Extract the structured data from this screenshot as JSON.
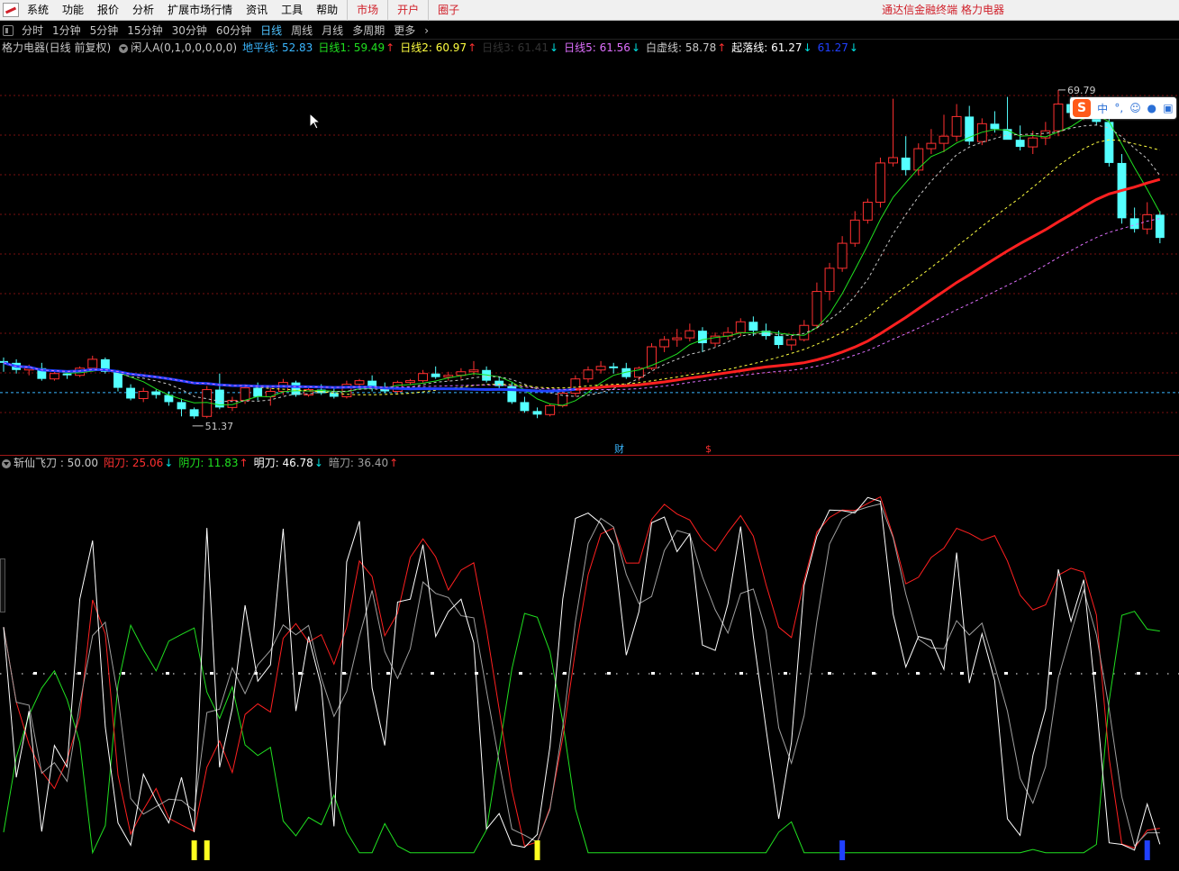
{
  "menu": {
    "items": [
      "系统",
      "功能",
      "报价",
      "分析",
      "扩展市场行情",
      "资讯",
      "工具",
      "帮助"
    ],
    "red_items": [
      "市场",
      "开户",
      "圈子"
    ],
    "right_title": "通达信金融终端   格力电器"
  },
  "periods": {
    "items": [
      "分时",
      "1分钟",
      "5分钟",
      "15分钟",
      "30分钟",
      "60分钟",
      "日线",
      "周线",
      "月线",
      "多周期",
      "更多"
    ],
    "active": "日线"
  },
  "main_legend": {
    "stock": "格力电器(日线 前复权)",
    "indicator": "闲人A(0,1,0,0,0,0,0)",
    "items": [
      {
        "label": "地平线: 52.83",
        "color": "#3ab7ff",
        "arrow": ""
      },
      {
        "label": "日线1: 59.49",
        "color": "#20e020",
        "arrow": "up"
      },
      {
        "label": "日线2: 60.97",
        "color": "#ffff40",
        "arrow": "up"
      },
      {
        "label": "日线3: 61.41",
        "color": "#333333",
        "arrow": "dn"
      },
      {
        "label": "日线5: 61.56",
        "color": "#e070ff",
        "arrow": "dn"
      },
      {
        "label": "白虚线: 58.78",
        "color": "#c8c8c8",
        "arrow": "up"
      },
      {
        "label": "起落线: 61.27",
        "color": "#ffffff",
        "arrow": "dn"
      },
      {
        "label": "61.27",
        "color": "#2040ff",
        "arrow": "dn"
      }
    ]
  },
  "sub_legend": {
    "name": "斩仙飞刀 : 50.00",
    "items": [
      {
        "label": "阳刀: 25.06",
        "color": "#ff3030",
        "arrow": "dn"
      },
      {
        "label": "阴刀: 11.83",
        "color": "#20e020",
        "arrow": "up"
      },
      {
        "label": "明刀: 46.78",
        "color": "#ffffff",
        "arrow": "dn"
      },
      {
        "label": "暗刀: 36.40",
        "color": "#a0a0a0",
        "arrow": "up"
      }
    ]
  },
  "annotations": {
    "high_price": "69.79",
    "low_price": "51.37",
    "finance_mark": "财",
    "dollar_mark": "$"
  },
  "ime": {
    "logo": "S",
    "mode": "中",
    "punct": "°,",
    "emoji": "☺",
    "mic": "🎤",
    "skin": "👕"
  },
  "colors": {
    "up_candle": "#ff3030",
    "down_candle": "#54ffff",
    "grid": "#7a1010",
    "horizon": "#3ab7ff"
  },
  "chart_data": {
    "type": "candlestick",
    "y_range": [
      50.0,
      71.5
    ],
    "x_count": 93,
    "candles": [
      [
        54.6,
        54.8,
        54.0,
        54.5
      ],
      [
        54.5,
        54.7,
        53.9,
        54.1
      ],
      [
        54.1,
        54.4,
        53.8,
        54.2
      ],
      [
        54.2,
        54.5,
        53.5,
        53.6
      ],
      [
        53.6,
        54.1,
        53.5,
        53.9
      ],
      [
        53.9,
        54.0,
        53.6,
        53.8
      ],
      [
        53.8,
        54.3,
        53.7,
        54.2
      ],
      [
        54.2,
        54.9,
        54.0,
        54.7
      ],
      [
        54.7,
        54.8,
        53.9,
        54.0
      ],
      [
        54.0,
        54.1,
        52.9,
        53.1
      ],
      [
        53.1,
        53.3,
        52.4,
        52.5
      ],
      [
        52.5,
        53.1,
        52.3,
        52.9
      ],
      [
        52.9,
        53.0,
        52.5,
        52.7
      ],
      [
        52.7,
        52.9,
        52.1,
        52.3
      ],
      [
        52.3,
        52.5,
        51.5,
        51.9
      ],
      [
        51.9,
        52.0,
        51.37,
        51.5
      ],
      [
        51.5,
        53.2,
        51.4,
        53.0
      ],
      [
        53.0,
        53.9,
        51.9,
        52.0
      ],
      [
        52.0,
        52.6,
        51.8,
        52.4
      ],
      [
        52.4,
        53.3,
        52.2,
        53.1
      ],
      [
        53.1,
        53.4,
        52.4,
        52.6
      ],
      [
        52.6,
        53.1,
        52.1,
        52.9
      ],
      [
        52.9,
        53.6,
        52.7,
        53.4
      ],
      [
        53.4,
        53.5,
        52.6,
        52.7
      ],
      [
        52.7,
        53.1,
        52.6,
        53.0
      ],
      [
        53.0,
        53.3,
        52.7,
        52.8
      ],
      [
        52.8,
        53.1,
        52.5,
        52.6
      ],
      [
        52.6,
        53.5,
        52.5,
        53.3
      ],
      [
        53.3,
        53.6,
        53.2,
        53.5
      ],
      [
        53.5,
        53.8,
        52.9,
        53.1
      ],
      [
        53.1,
        53.4,
        52.8,
        52.9
      ],
      [
        52.9,
        53.5,
        52.8,
        53.4
      ],
      [
        53.4,
        53.6,
        53.3,
        53.5
      ],
      [
        53.5,
        54.1,
        53.4,
        53.9
      ],
      [
        53.9,
        54.3,
        53.6,
        53.7
      ],
      [
        53.7,
        54.0,
        53.5,
        53.8
      ],
      [
        53.8,
        54.2,
        53.6,
        54.0
      ],
      [
        54.0,
        54.6,
        53.8,
        54.1
      ],
      [
        54.1,
        54.3,
        53.4,
        53.5
      ],
      [
        53.5,
        53.7,
        53.0,
        53.2
      ],
      [
        53.2,
        53.4,
        52.2,
        52.3
      ],
      [
        52.3,
        52.6,
        51.7,
        51.8
      ],
      [
        51.8,
        52.0,
        51.4,
        51.6
      ],
      [
        51.6,
        52.2,
        51.5,
        52.1
      ],
      [
        52.1,
        52.9,
        52.0,
        52.8
      ],
      [
        52.8,
        53.8,
        52.6,
        53.6
      ],
      [
        53.6,
        54.3,
        53.4,
        54.1
      ],
      [
        54.1,
        54.6,
        53.9,
        54.3
      ],
      [
        54.3,
        54.5,
        53.9,
        54.2
      ],
      [
        54.2,
        54.5,
        53.6,
        53.7
      ],
      [
        53.7,
        54.3,
        53.5,
        54.2
      ],
      [
        54.2,
        55.6,
        54.1,
        55.4
      ],
      [
        55.4,
        56.0,
        55.1,
        55.8
      ],
      [
        55.8,
        56.4,
        55.4,
        55.9
      ],
      [
        55.9,
        56.7,
        55.7,
        56.3
      ],
      [
        56.3,
        56.5,
        55.1,
        55.6
      ],
      [
        55.6,
        56.2,
        55.4,
        56.0
      ],
      [
        56.0,
        56.5,
        55.8,
        56.2
      ],
      [
        56.2,
        57.0,
        56.0,
        56.8
      ],
      [
        56.8,
        57.1,
        56.0,
        56.3
      ],
      [
        56.3,
        56.7,
        55.8,
        56.0
      ],
      [
        56.0,
        56.3,
        55.3,
        55.5
      ],
      [
        55.5,
        56.0,
        55.2,
        55.8
      ],
      [
        55.8,
        56.9,
        55.7,
        56.6
      ],
      [
        56.6,
        59.0,
        56.4,
        58.5
      ],
      [
        58.5,
        60.1,
        58.0,
        59.8
      ],
      [
        59.8,
        61.6,
        59.6,
        61.2
      ],
      [
        61.2,
        63.0,
        61.0,
        62.5
      ],
      [
        62.5,
        63.7,
        62.3,
        63.5
      ],
      [
        63.5,
        66.0,
        63.2,
        65.7
      ],
      [
        65.7,
        69.3,
        65.5,
        66.0
      ],
      [
        66.0,
        67.2,
        65.0,
        65.3
      ],
      [
        65.3,
        66.8,
        65.0,
        66.5
      ],
      [
        66.5,
        67.6,
        66.2,
        66.8
      ],
      [
        66.8,
        68.4,
        66.3,
        67.2
      ],
      [
        67.2,
        69.0,
        66.9,
        68.3
      ],
      [
        68.3,
        68.9,
        66.7,
        66.9
      ],
      [
        66.9,
        68.2,
        66.7,
        67.9
      ],
      [
        67.9,
        68.6,
        67.4,
        67.6
      ],
      [
        67.6,
        69.4,
        67.2,
        67.0
      ],
      [
        67.0,
        67.8,
        66.4,
        66.6
      ],
      [
        66.6,
        67.5,
        66.2,
        67.1
      ],
      [
        67.1,
        68.0,
        66.7,
        67.5
      ],
      [
        67.5,
        69.79,
        67.2,
        69.0
      ],
      [
        69.0,
        69.4,
        68.3,
        68.5
      ],
      [
        68.5,
        69.2,
        68.1,
        68.9
      ],
      [
        68.9,
        69.0,
        67.8,
        68.0
      ],
      [
        68.0,
        68.2,
        65.5,
        65.7
      ],
      [
        65.7,
        66.2,
        62.3,
        62.6
      ],
      [
        62.6,
        63.2,
        61.8,
        62.0
      ],
      [
        62.0,
        63.5,
        61.7,
        62.8
      ],
      [
        62.8,
        63.0,
        61.2,
        61.5
      ]
    ]
  }
}
